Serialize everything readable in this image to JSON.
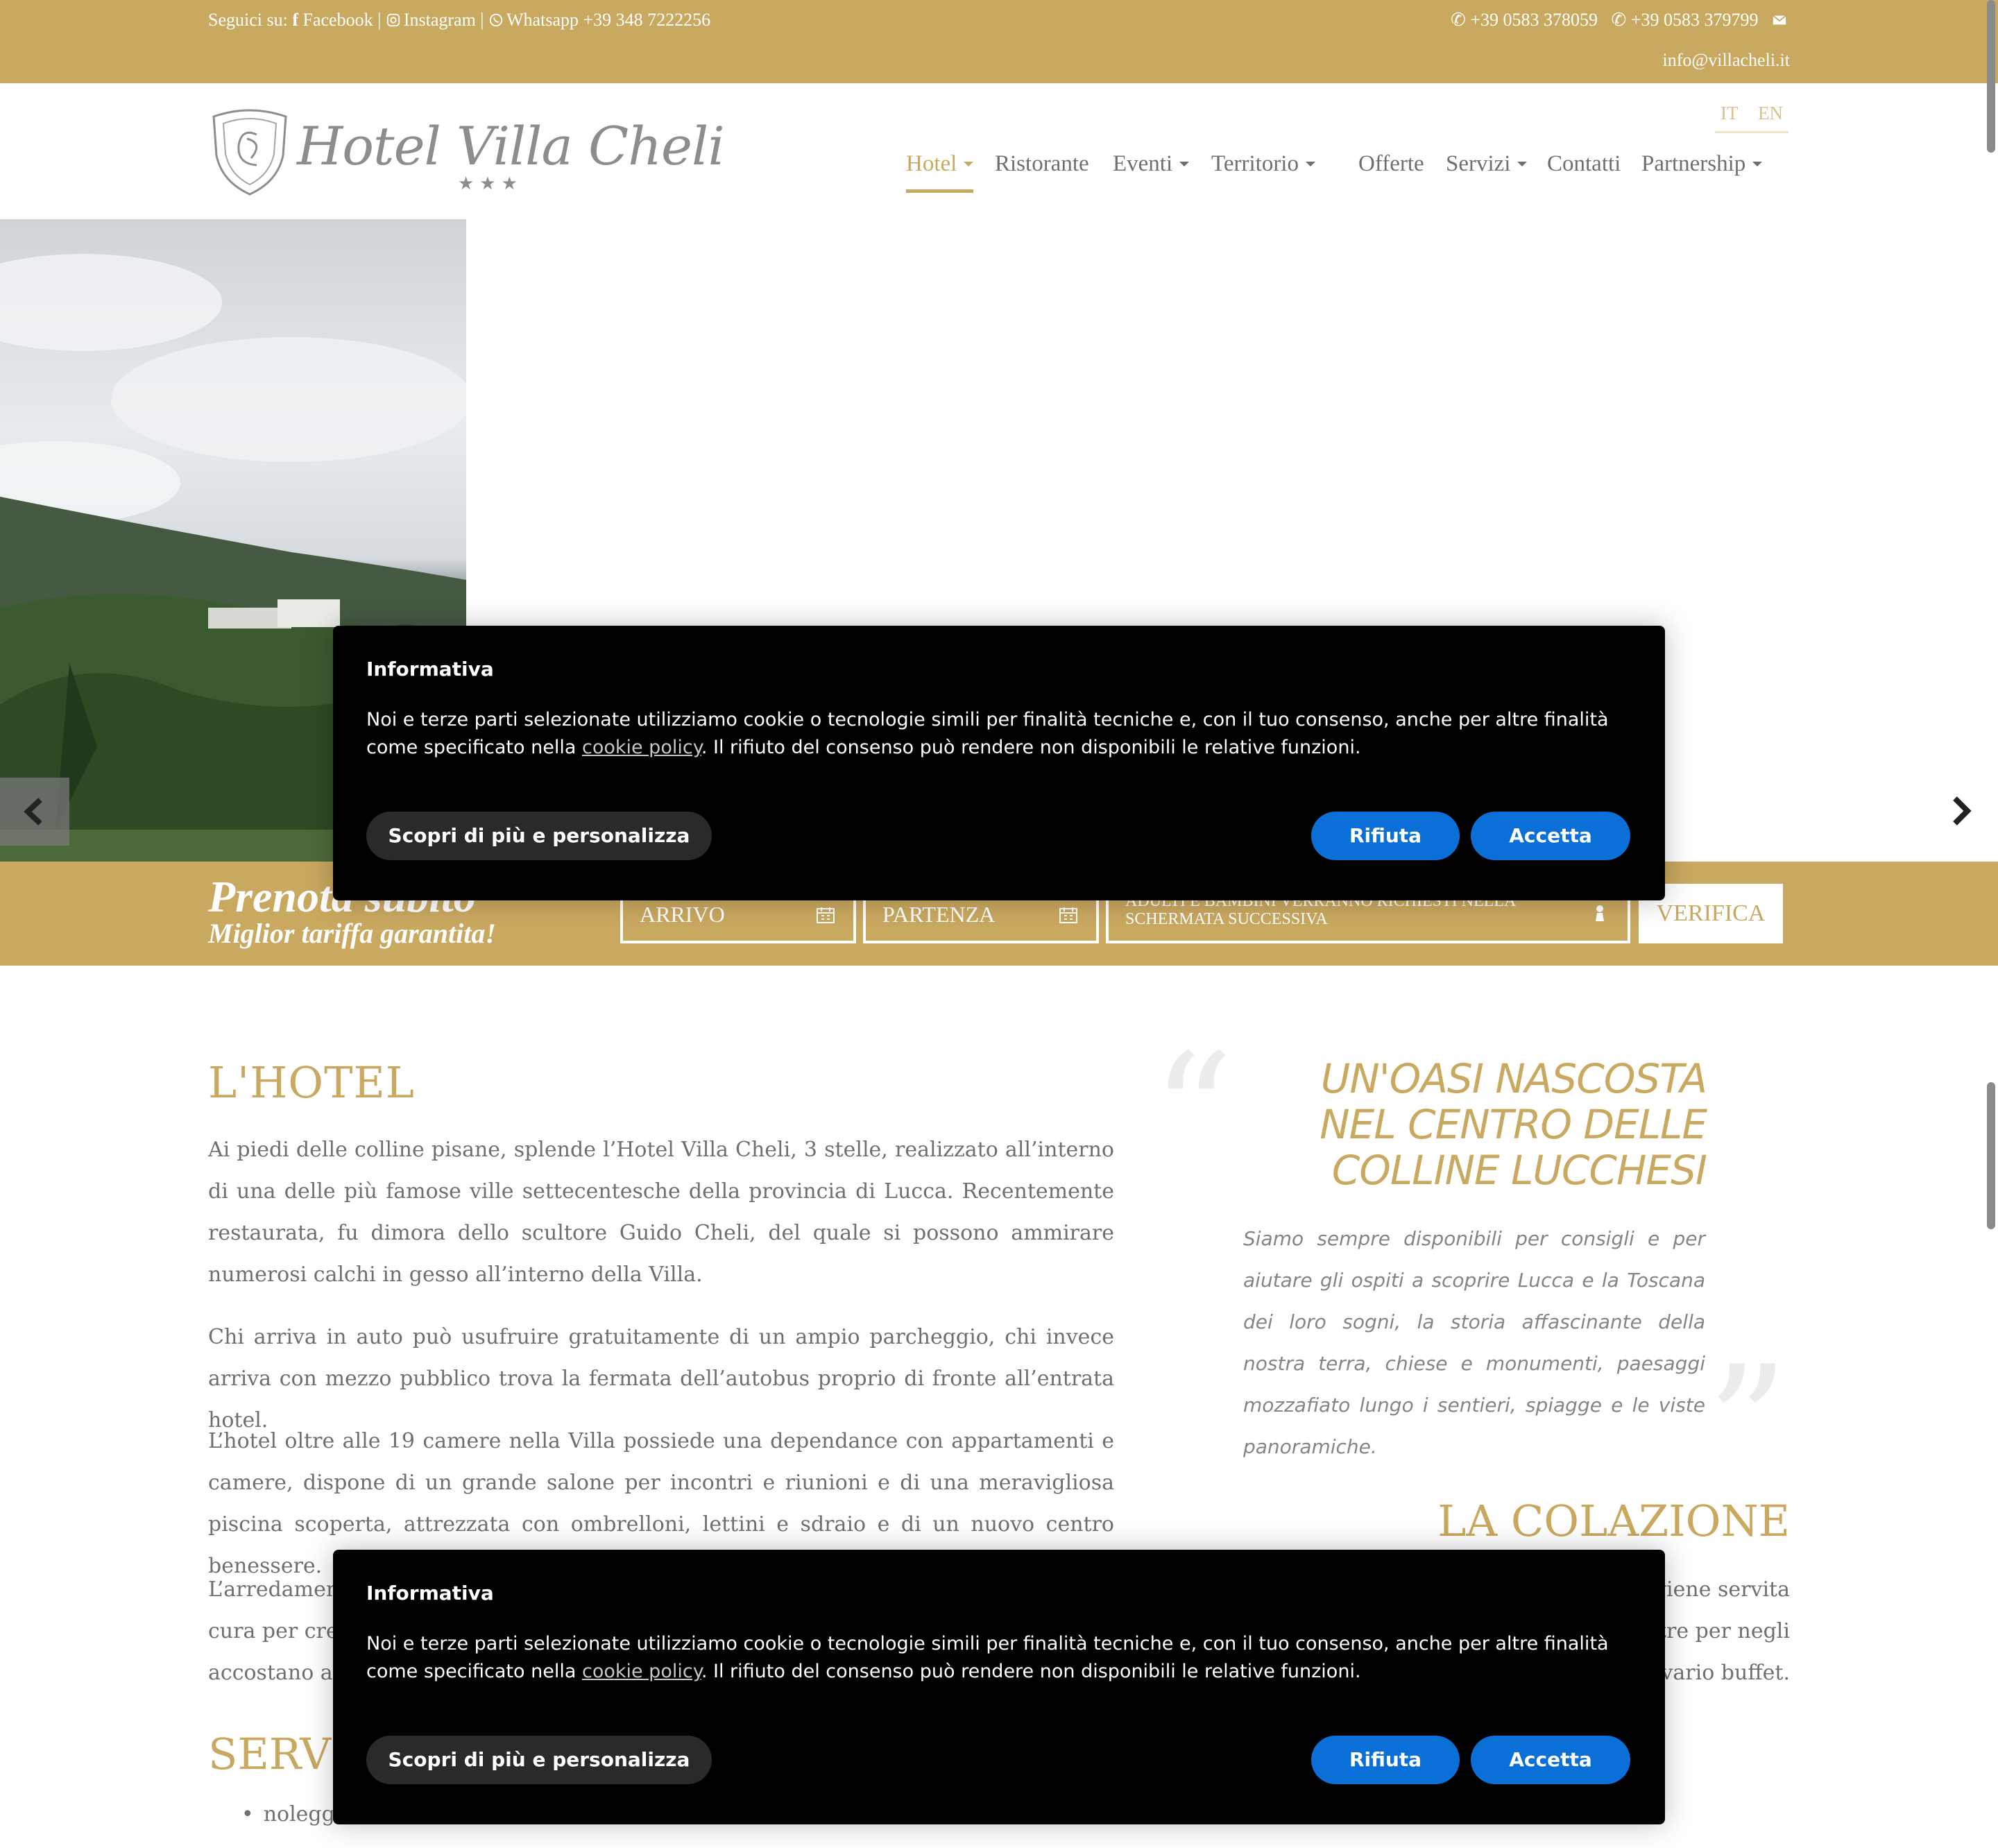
{
  "topbar": {
    "follow_label": "Seguici su:",
    "facebook": "Facebook",
    "instagram": "Instagram",
    "whatsapp": "Whatsapp +39 348 7222256",
    "phone1": "+39 0583 378059",
    "phone2": "+39 0583 379799",
    "email": "info@villacheli.it"
  },
  "logo": {
    "name": "Hotel Villa Cheli",
    "stars": "★★★"
  },
  "lang": {
    "it": "IT",
    "en": "EN"
  },
  "nav": [
    {
      "label": "Hotel",
      "dropdown": true,
      "active": true
    },
    {
      "label": "Ristorante",
      "dropdown": false
    },
    {
      "label": "Eventi",
      "dropdown": true
    },
    {
      "label": "Territorio",
      "dropdown": true
    },
    {
      "label": "Offerte",
      "dropdown": false
    },
    {
      "label": "Servizi",
      "dropdown": true
    },
    {
      "label": "Contatti",
      "dropdown": false
    },
    {
      "label": "Partnership",
      "dropdown": true
    }
  ],
  "booking": {
    "title": "Prenota subito",
    "subtitle": "Miglior tariffa garantita!",
    "arrivo": "ARRIVO",
    "partenza": "PARTENZA",
    "guests": "ADULTI E BAMBINI VERRANNO RICHIESTI NELLA SCHERMATA SUCCESSIVA",
    "verify": "VERIFICA"
  },
  "hotel": {
    "heading": "L'HOTEL",
    "p1": "Ai piedi delle colline pisane, splende l’Hotel Villa Cheli, 3 stelle, realizzato all’interno di una delle più famose ville settecentesche della provincia di Lucca. Recentemente restaurata, fu dimora dello scultore Guido Cheli, del quale si possono ammirare numerosi calchi in gesso all’interno della Villa.",
    "p2": "Chi arriva in auto può usufruire gratuitamente di un ampio parcheggio, chi invece arriva con mezzo pubblico trova la fermata dell’autobus proprio di fronte all’entrata hotel.",
    "p3": "L’hotel oltre alle 19 camere nella Villa possiede una dependance con appartamenti e camere, dispone di un grande salone per incontri e riunioni e di una meravigliosa piscina scoperta, attrezzata con ombrelloni, lettini e sdraio e di un nuovo centro benessere.",
    "p4_line1": "L’arredamen",
    "p4_line2": "cura per cre",
    "p4_line3": "accostano ai"
  },
  "oasi": {
    "quote_open": "“",
    "quote_close": "”",
    "heading": "UN'OASI NASCOSTA NEL CENTRO DELLE COLLINE LUCCHESI",
    "text": "Siamo sempre disponibili per consigli e per aiutare gli ospiti a scoprire Lucca e la Toscana dei loro sogni, la storia affascinante della nostra terra, chiese e monumenti, paesaggi mozzafiato lungo i sentieri, spiagge e le viste panoramiche."
  },
  "colazione": {
    "heading": "LA COLAZIONE",
    "line1": "viene servita",
    "line2": "tre per negli",
    "line3": "vario buffet."
  },
  "servizi": {
    "heading": "SERVI",
    "item1": "noleggio biciclette"
  },
  "cookie": {
    "title": "Informativa",
    "text_before": "Noi e terze parti selezionate utilizziamo cookie o tecnologie simili per finalità tecniche e, con il tuo consenso, anche per altre finalità come specificato nella ",
    "policy_link": "cookie policy",
    "text_after": ". Il rifiuto del consenso può rendere non disponibili le relative funzioni.",
    "more_button": "Scopri di più e personalizza",
    "reject_button": "Rifiuta",
    "accept_button": "Accetta"
  },
  "colors": {
    "gold": "#c9a860",
    "blue": "#0a6fd6"
  }
}
